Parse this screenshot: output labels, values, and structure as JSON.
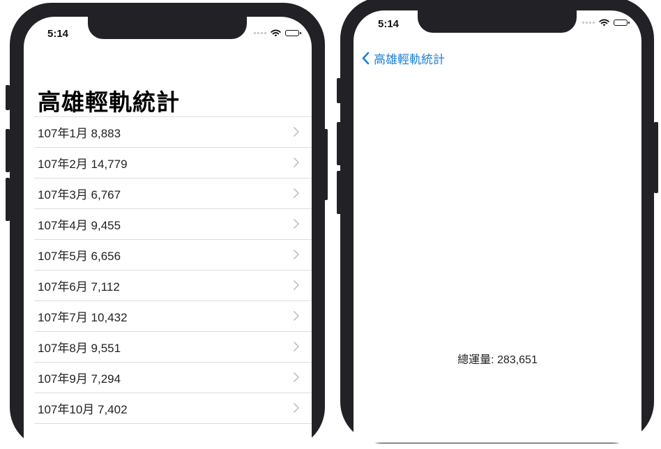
{
  "left_screen": {
    "status_time": "5:14",
    "title": "高雄輕軌統計",
    "rows": [
      {
        "label": "107年1月  8,883"
      },
      {
        "label": "107年2月  14,779"
      },
      {
        "label": "107年3月  6,767"
      },
      {
        "label": "107年4月  9,455"
      },
      {
        "label": "107年5月  6,656"
      },
      {
        "label": "107年6月  7,112"
      },
      {
        "label": "107年7月  10,432"
      },
      {
        "label": "107年8月  9,551"
      },
      {
        "label": "107年9月  7,294"
      },
      {
        "label": "107年10月  7,402"
      }
    ]
  },
  "right_screen": {
    "status_time": "5:14",
    "back_label": "高雄輕軌統計",
    "total_text": "總運量: 283,651"
  },
  "colors": {
    "accent_blue": "#1a7fd6",
    "phone_frame": "#222226",
    "separator": "#dcdce0"
  },
  "icons": {
    "row_disclosure": "chevron-right-icon",
    "back": "chevron-left-icon",
    "wifi": "wifi-icon",
    "battery": "battery-icon",
    "signal": "cellular-signal-icon"
  }
}
